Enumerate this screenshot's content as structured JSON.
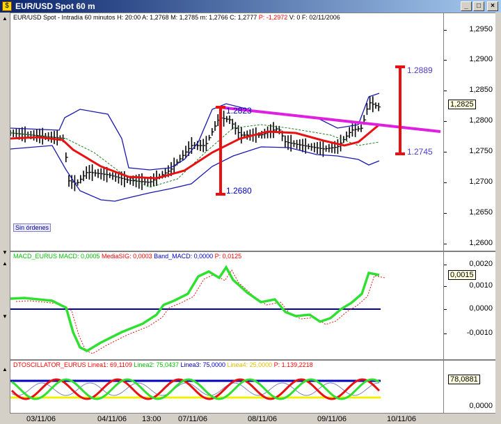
{
  "window": {
    "title": "EUR/USD Spot 60 m"
  },
  "price_panel": {
    "header": [
      {
        "text": "EUR/USD Spot - Intradía 60 minutos  H: 20:00  A: 1,2768  M: 1,2785  m: 1,2766  C: 1,2777  ",
        "color": "#000000"
      },
      {
        "text": "P: -1,2972",
        "color": "#ff0000"
      },
      {
        "text": "  V: 0  F: 02/11/2006",
        "color": "#000000"
      }
    ],
    "y_ticks": [
      "1,2950",
      "1,2900",
      "1,2850",
      "1,2800",
      "1,2750",
      "1,2700",
      "1,2650",
      "1,2600"
    ],
    "last_price": "1,2825",
    "labels": {
      "low": "1.2680",
      "high": "1.2823",
      "target_high": "1.2889",
      "target_low": "1.2745"
    },
    "status_button": "Sin órdenes"
  },
  "macd_panel": {
    "header": [
      {
        "text": "MACD_EURUS  MACD: 0,0005  ",
        "color": "#00c000"
      },
      {
        "text": "MediaSIG: 0,0003  ",
        "color": "#ff0000"
      },
      {
        "text": "Band_MACD: 0,0000  ",
        "color": "#0000c0"
      },
      {
        "text": "P: 0,0125",
        "color": "#ff0000"
      }
    ],
    "y_ticks": [
      "0,0020",
      "0,0010",
      "0,0000",
      "-0,0010"
    ],
    "last_value": "0,0015"
  },
  "osc_panel": {
    "header": [
      {
        "text": "DTOSCILLATOR_EURUS  Linea1: 69,1109  ",
        "color": "#ff0000"
      },
      {
        "text": "Linea2: 75,0437  ",
        "color": "#00c000"
      },
      {
        "text": "Linea3: 75,0000  ",
        "color": "#0000c0"
      },
      {
        "text": "Linea4: 25,0000  ",
        "color": "#e0c000"
      },
      {
        "text": "P: 1.139,2218",
        "color": "#ff0000"
      }
    ],
    "y_ticks": [
      "0,0000"
    ],
    "last_value": "78,0881"
  },
  "x_dates": [
    "03/11/06",
    "04/11/06",
    "13:00",
    "07/11/06",
    "08/11/06",
    "09/11/06",
    "10/11/06"
  ],
  "colors": {
    "ma": "#e81010",
    "bollinger": "#1818b0",
    "trend": "#e020e0",
    "macd": "#30e030",
    "signal": "#e81010",
    "zero": "#0000a0"
  }
}
